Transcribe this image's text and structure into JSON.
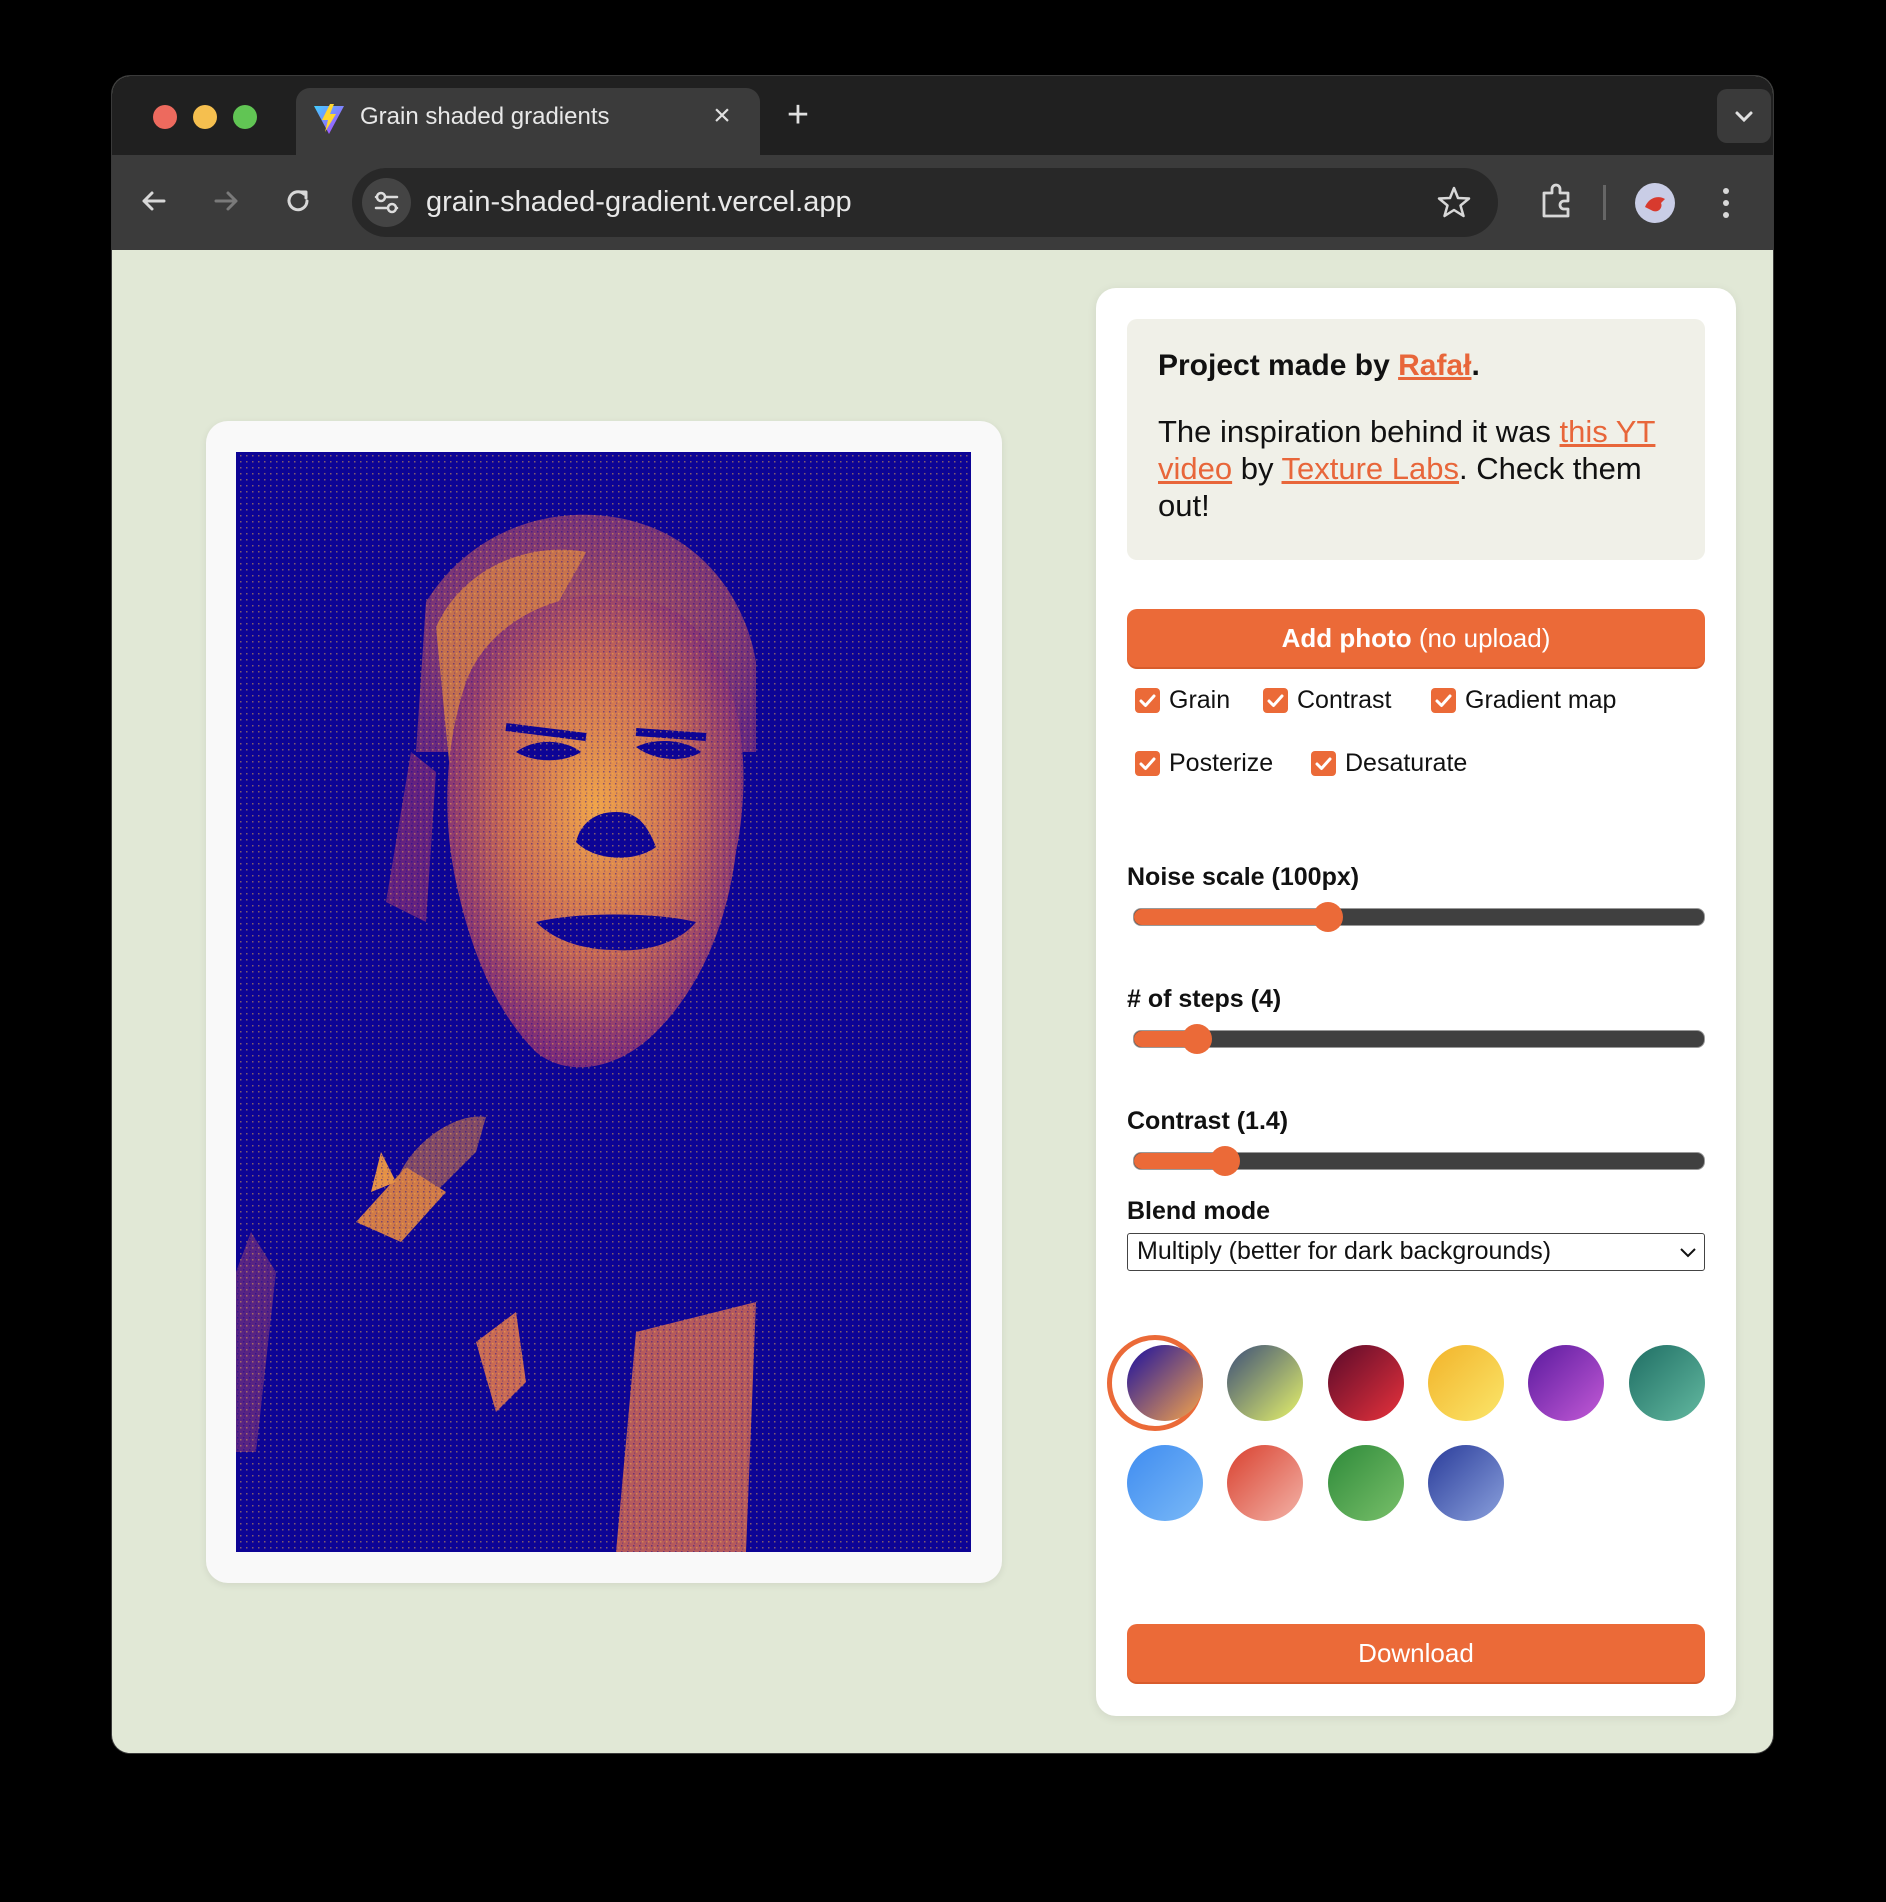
{
  "browser": {
    "tab_title": "Grain shaded gradients",
    "tab_close": "×",
    "new_tab": "+",
    "url": "grain-shaded-gradient.vercel.app"
  },
  "info": {
    "made_by_prefix": "Project made by ",
    "author": "Rafał",
    "made_by_suffix": ".",
    "inspiration_prefix": "The inspiration behind it was ",
    "video_link": "this YT video",
    "by": " by ",
    "channel_link": "Texture Labs",
    "inspiration_suffix": ". Check them out!"
  },
  "add_photo": {
    "label": "Add photo",
    "note": " (no upload)"
  },
  "options": [
    {
      "label": "Grain",
      "checked": true
    },
    {
      "label": "Contrast",
      "checked": true
    },
    {
      "label": "Gradient map",
      "checked": true
    },
    {
      "label": "Posterize",
      "checked": true
    },
    {
      "label": "Desaturate",
      "checked": true
    }
  ],
  "sliders": [
    {
      "label": "Noise scale (100px)",
      "value": 0.34
    },
    {
      "label": "# of steps (4)",
      "value": 0.11
    },
    {
      "label": "Contrast (1.4)",
      "value": 0.16
    }
  ],
  "blend": {
    "label": "Blend mode",
    "selected": "Multiply (better for dark backgrounds)"
  },
  "palettes": [
    {
      "name": "indigo-orange-gradient",
      "from": "#1a0fa0",
      "to": "#f7a64a",
      "selected": true
    },
    {
      "name": "slate-lime-gradient",
      "from": "#3b4e78",
      "to": "#e7f36a",
      "selected": false
    },
    {
      "name": "crimson-gradient",
      "from": "#5a0a2a",
      "to": "#e8323c",
      "selected": false
    },
    {
      "name": "amber-gradient",
      "from": "#f2b32a",
      "to": "#fbe66a",
      "selected": false
    },
    {
      "name": "violet-gradient",
      "from": "#5a1a9e",
      "to": "#c35ad6",
      "selected": false
    },
    {
      "name": "teal-gradient",
      "from": "#1f6e64",
      "to": "#63b9a0",
      "selected": false
    },
    {
      "name": "sky-gradient",
      "from": "#3f8cf0",
      "to": "#7ab9f7",
      "selected": false
    },
    {
      "name": "coral-gradient",
      "from": "#d9412f",
      "to": "#f3b3a8",
      "selected": false
    },
    {
      "name": "green-gradient",
      "from": "#2e8a3a",
      "to": "#79c06a",
      "selected": false
    },
    {
      "name": "blue-gradient",
      "from": "#2a3c9a",
      "to": "#8aa0dc",
      "selected": false
    }
  ],
  "download": {
    "label": "Download"
  }
}
